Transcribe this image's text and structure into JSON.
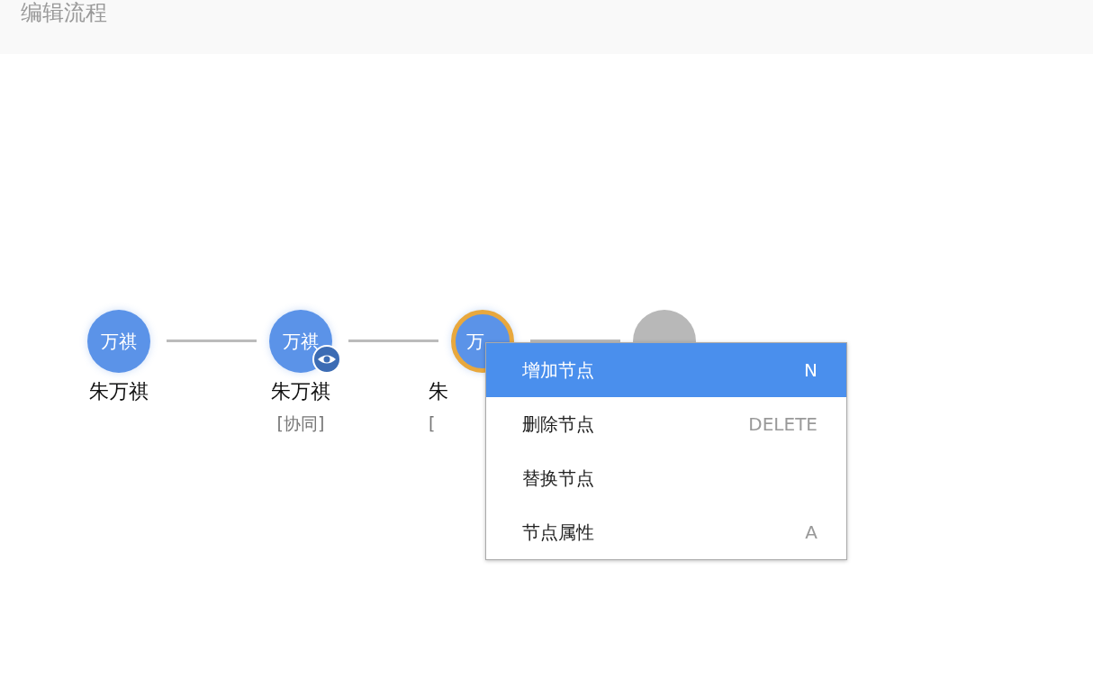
{
  "header": {
    "title": "编辑流程"
  },
  "flow": {
    "nodes": [
      {
        "kind": "person",
        "avatar": "万祺",
        "name": "朱万祺",
        "selected": false,
        "watching": false
      },
      {
        "kind": "person",
        "avatar": "万祺",
        "name": "朱万祺",
        "role": "[协同]",
        "selected": false,
        "watching": true
      },
      {
        "kind": "person",
        "avatar": "万",
        "name": "朱",
        "role": "[",
        "selected": true,
        "watching": false
      },
      {
        "kind": "end",
        "selected": false,
        "watching": false
      }
    ]
  },
  "context_menu": {
    "items": [
      {
        "label": "增加节点",
        "shortcut": "N",
        "selected": true
      },
      {
        "label": "删除节点",
        "shortcut": "DELETE",
        "selected": false
      },
      {
        "label": "替换节点",
        "selected": false
      },
      {
        "label": "节点属性",
        "shortcut": "A",
        "selected": false
      }
    ]
  }
}
